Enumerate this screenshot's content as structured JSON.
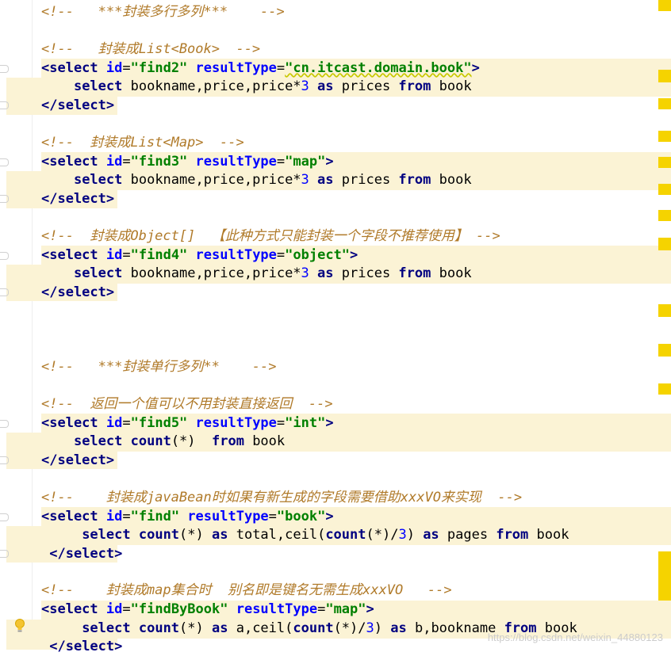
{
  "editor": {
    "lines": [
      {
        "id": "c1",
        "comment": "<!--   ***封装多行多列***    -->"
      },
      {
        "id": "c2",
        "comment": "<!--   封装成List<Book>  -->"
      },
      {
        "id": "s1o",
        "tag_open": "<select",
        "attr1": "id",
        "val1": "\"find2\"",
        "attr2": "resultType",
        "val2": "\"cn.itcast.domain.book\"",
        "tag_close": ">"
      },
      {
        "id": "s1b",
        "kw1": "select",
        "text1": " bookname,price,price*",
        "num": "3",
        "kw2": "as",
        "text2": " prices ",
        "kw3": "from",
        "text3": " book"
      },
      {
        "id": "s1c",
        "tag": "</select>"
      },
      {
        "id": "c3",
        "comment": "<!--  封装成List<Map>  -->"
      },
      {
        "id": "s2o",
        "tag_open": "<select",
        "attr1": "id",
        "val1": "\"find3\"",
        "attr2": "resultType",
        "val2": "\"map\"",
        "tag_close": ">"
      },
      {
        "id": "s2b",
        "kw1": "select",
        "text1": " bookname,price,price*",
        "num": "3",
        "kw2": "as",
        "text2": " prices ",
        "kw3": "from",
        "text3": " book"
      },
      {
        "id": "s2c",
        "tag": "</select>"
      },
      {
        "id": "c4",
        "comment": "<!--  封装成Object[]  【此种方式只能封装一个字段不推荐使用】 -->"
      },
      {
        "id": "s3o",
        "tag_open": "<select",
        "attr1": "id",
        "val1": "\"find4\"",
        "attr2": "resultType",
        "val2": "\"object\"",
        "tag_close": ">"
      },
      {
        "id": "s3b",
        "kw1": "select",
        "text1": " bookname,price,price*",
        "num": "3",
        "kw2": "as",
        "text2": " prices ",
        "kw3": "from",
        "text3": " book"
      },
      {
        "id": "s3c",
        "tag": "</select>"
      },
      {
        "id": "c5",
        "comment": "<!--   ***封装单行多列**    -->"
      },
      {
        "id": "c6",
        "comment": "<!--  返回一个值可以不用封装直接返回  -->"
      },
      {
        "id": "s4o",
        "tag_open": "<select",
        "attr1": "id",
        "val1": "\"find5\"",
        "attr2": "resultType",
        "val2": "\"int\"",
        "tag_close": ">"
      },
      {
        "id": "s4b",
        "kw1": "select",
        "kw2": "count",
        "text1": "(*)  ",
        "kw3": "from",
        "text2": " book"
      },
      {
        "id": "s4c",
        "tag": "</select>"
      },
      {
        "id": "c7",
        "comment": "<!--    封装成javaBean时如果有新生成的字段需要借助xxxVO来实现  -->"
      },
      {
        "id": "s5o",
        "tag_open": "<select",
        "attr1": "id",
        "val1": "\"find\"",
        "attr2": "resultType",
        "val2": "\"book\"",
        "tag_close": ">"
      },
      {
        "id": "s5b",
        "kw1": "select",
        "kw2": "count",
        "t1": "(*) ",
        "kw3": "as",
        "t2": " total,ceil(",
        "kw4": "count",
        "t3": "(*)/",
        "num": "3",
        "t4": ") ",
        "kw5": "as",
        "t5": " pages ",
        "kw6": "from",
        "t6": " book"
      },
      {
        "id": "s5c",
        "tag": "</select>"
      },
      {
        "id": "c8",
        "comment": "<!--    封装成map集合时  别名即是键名无需生成xxxVO   -->"
      },
      {
        "id": "s6o",
        "tag_open": "<select",
        "attr1": "id",
        "val1": "\"findByBook\"",
        "attr2": "resultType",
        "val2": "\"map\"",
        "tag_close": ">"
      },
      {
        "id": "s6b",
        "kw1": "select",
        "kw2": "count",
        "t1": "(*) ",
        "kw3": "as",
        "t2": " a,ceil(",
        "kw4": "count",
        "t3": "(*)/",
        "num": "3",
        "t4": ") ",
        "kw5": "as",
        "t5": " b,bookname ",
        "kw6": "from",
        "t6": " book"
      },
      {
        "id": "s6c",
        "tag": "</select>"
      }
    ]
  },
  "watermark": "https://blog.csdn.net/weixin_44880123",
  "colors": {
    "comment": "#b07a29",
    "tag": "#000080",
    "attr": "#0000ff",
    "string": "#008000",
    "highlight": "#fbf3d5",
    "marker": "#f5d300"
  }
}
